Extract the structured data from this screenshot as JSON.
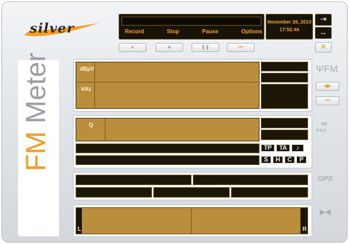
{
  "logo": {
    "text": "silver"
  },
  "controls": {
    "record": "Record",
    "stop": "Stop",
    "pause": "Pause",
    "options": "Options"
  },
  "datetime": {
    "date": "November 26, 2010",
    "time": "17:52:44"
  },
  "title": {
    "fm": "FM",
    "meter": "Meter"
  },
  "level_panel": {
    "label_top": "dBµV",
    "label_bottom": "kHz"
  },
  "quality_panel": {
    "label": "Q"
  },
  "rds_flags": [
    "TP",
    "TA",
    "♪",
    "S",
    "H",
    "C",
    "P"
  ],
  "side_icons": {
    "fm": "FM",
    "rds": "R·D·S",
    "gps": "GPS"
  },
  "stereo_panel": {
    "left": "L",
    "right": "R"
  },
  "colors": {
    "accent": "#f39c1e",
    "display_bg": "#1a1408",
    "bar": "#bb8e3e"
  }
}
